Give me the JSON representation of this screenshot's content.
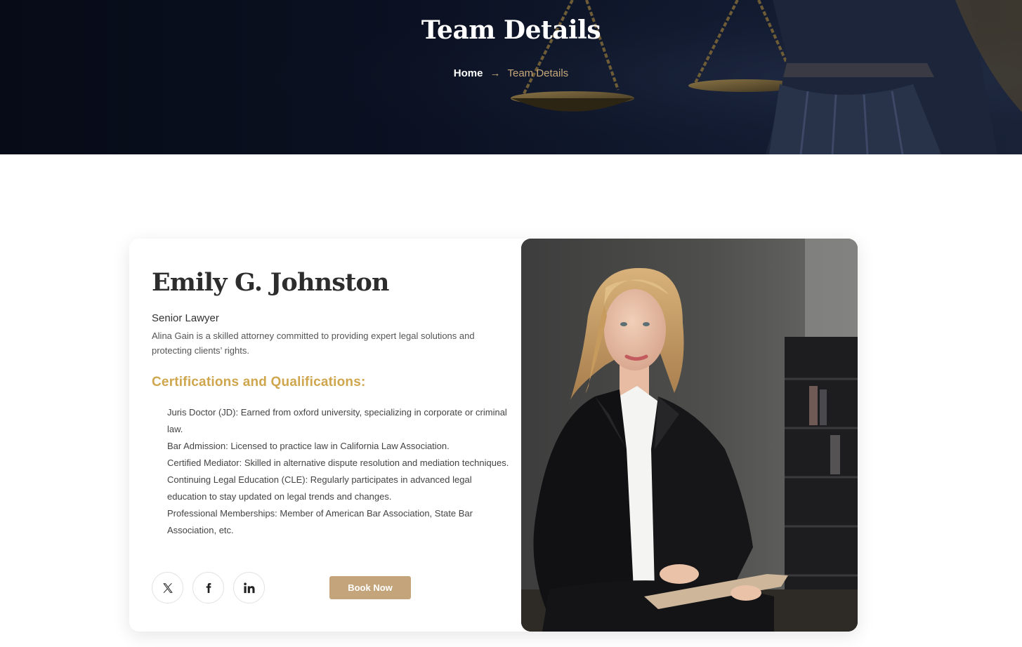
{
  "hero": {
    "title": "Team Details",
    "breadcrumb": {
      "home": "Home",
      "separator": "→",
      "current": "Team Details"
    }
  },
  "profile": {
    "name": "Emily G. Johnston",
    "role": "Senior Lawyer",
    "bio": "Alina Gain is a skilled attorney committed to providing expert legal solutions and protecting clients’ rights.",
    "certifications_title": "Certifications and Qualifications:",
    "certifications": [
      "Juris Doctor (JD): Earned from oxford university, specializing in  corporate or criminal law.",
      "Bar Admission: Licensed to practice law in California Law Association.",
      "Certified Mediator: Skilled in alternative dispute resolution and mediation techniques.",
      "Continuing Legal Education (CLE): Regularly participates in advanced legal education to stay updated on legal trends and changes.",
      "Professional Memberships: Member of  American Bar Association, State Bar Association, etc."
    ],
    "book_button": "Book Now",
    "social": [
      {
        "icon": "x-icon"
      },
      {
        "icon": "facebook-icon"
      },
      {
        "icon": "linkedin-icon"
      }
    ]
  },
  "colors": {
    "accent_gold": "#cfa64e",
    "button_tan": "#c4a47a",
    "hero_navy": "#0b1122"
  }
}
